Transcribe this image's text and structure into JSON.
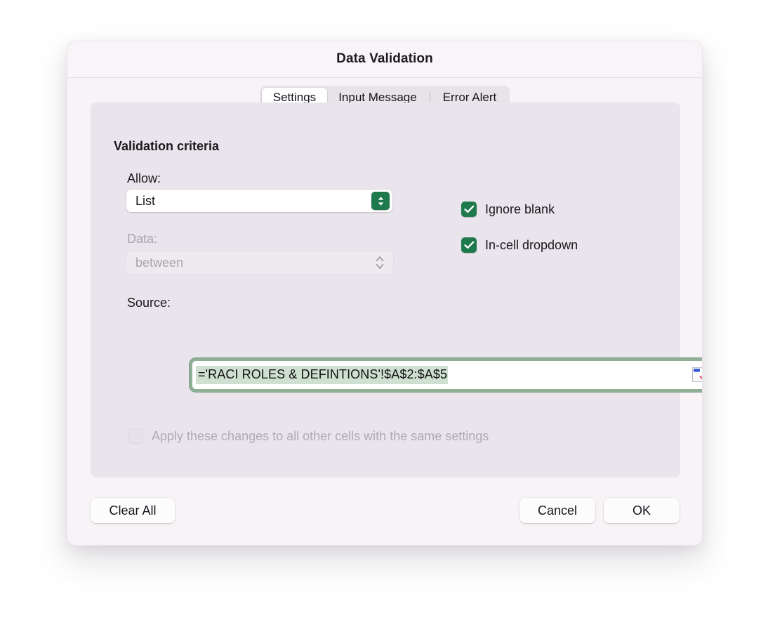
{
  "dialog": {
    "title": "Data Validation"
  },
  "tabs": [
    {
      "label": "Settings",
      "selected": true
    },
    {
      "label": "Input Message",
      "selected": false
    },
    {
      "label": "Error Alert",
      "selected": false
    }
  ],
  "settings": {
    "section_title": "Validation criteria",
    "allow": {
      "label": "Allow:",
      "value": "List",
      "stepper_icon": "chevron-up-down-icon",
      "enabled": true
    },
    "data": {
      "label": "Data:",
      "value": "between",
      "stepper_icon": "chevron-up-down-icon",
      "enabled": false
    },
    "ignore_blank": {
      "label": "Ignore blank",
      "checked": true
    },
    "in_cell_dropdown": {
      "label": "In-cell dropdown",
      "checked": true
    },
    "source": {
      "label": "Source:",
      "value": "='RACI ROLES & DEFINTIONS'!$A$2:$A$5",
      "placeholder": "",
      "picker_icon": "range-selector-icon",
      "focused": true,
      "text_selected": true
    },
    "apply_all": {
      "label": "Apply these changes to all other cells with the same settings",
      "checked": false,
      "enabled": false
    }
  },
  "footer": {
    "clear_all": "Clear All",
    "cancel": "Cancel",
    "ok": "OK"
  },
  "colors": {
    "accent_green": "#1e7a4d",
    "focus_ring": "#8fae96",
    "selection": "#cfe0d0",
    "dialog_bg": "#f7f3f6",
    "panel_bg": "#eae5ec"
  }
}
